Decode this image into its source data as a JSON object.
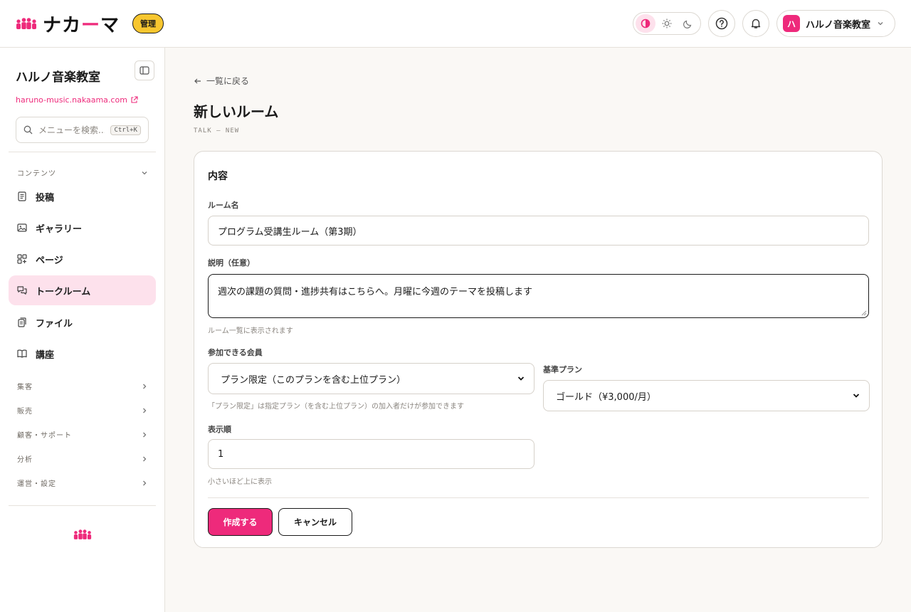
{
  "header": {
    "logo_text_a": "ナカ",
    "logo_text_b": "ー",
    "logo_text_c": "マ",
    "admin_badge": "管理",
    "account_initial": "ハ",
    "account_name": "ハルノ音楽教室",
    "brand_color": "#ee2a7b"
  },
  "sidebar": {
    "title": "ハルノ音楽教室",
    "url": "haruno-music.nakaama.com",
    "search_placeholder": "メニューを検索...",
    "search_shortcut": "Ctrl+K",
    "section_content": "コンテンツ",
    "items": [
      {
        "label": "投稿",
        "icon": "document-icon"
      },
      {
        "label": "ギャラリー",
        "icon": "image-icon"
      },
      {
        "label": "ページ",
        "icon": "layout-icon"
      },
      {
        "label": "トークルーム",
        "icon": "chat-icon"
      },
      {
        "label": "ファイル",
        "icon": "files-icon"
      },
      {
        "label": "講座",
        "icon": "book-icon"
      }
    ],
    "sections": [
      "集客",
      "販売",
      "顧客・サポート",
      "分析",
      "運営・設定"
    ]
  },
  "main": {
    "back_label": "一覧に戻る",
    "title": "新しいルーム",
    "subtitle": "TALK — NEW",
    "card_title": "内容",
    "room_name_label": "ルーム名",
    "room_name_value": "プログラム受講生ルーム（第3期）",
    "desc_label": "説明（任意）",
    "desc_value": "週次の課題の質問・進捗共有はこちらへ。月曜に今週のテーマを投稿します",
    "desc_hint": "ルーム一覧に表示されます",
    "members_label": "参加できる会員",
    "members_value": "プラン限定（このプランを含む上位プラン）",
    "members_hint": "「プラン限定」は指定プラン（を含む上位プラン）の加入者だけが参加できます",
    "plan_label": "基準プラン",
    "plan_value": "ゴールド（¥3,000/月）",
    "order_label": "表示順",
    "order_value": "1",
    "order_hint": "小さいほど上に表示",
    "create_label": "作成する",
    "cancel_label": "キャンセル"
  }
}
